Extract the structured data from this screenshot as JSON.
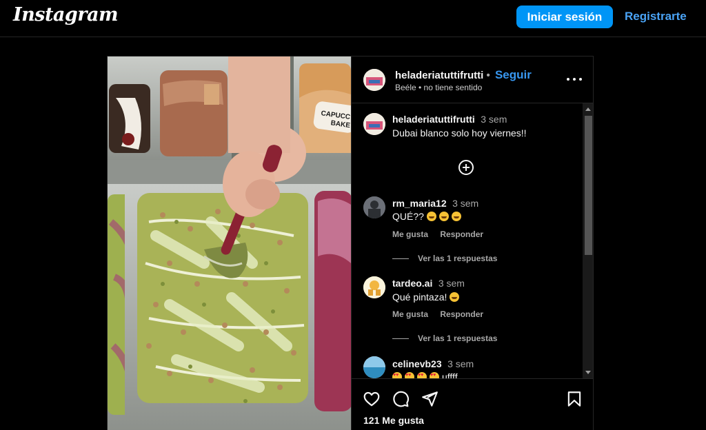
{
  "app": {
    "logo": "Instagram",
    "login_label": "Iniciar sesión",
    "register_label": "Registrarte"
  },
  "post": {
    "username": "heladeriatuttifrutti",
    "follow_label": "Seguir",
    "audio": "Beéle • no tiene sentido",
    "likes": "121 Me gusta"
  },
  "caption": {
    "username": "heladeriatuttifrutti",
    "time": "3 sem",
    "text": "Dubai blanco solo hoy viernes!!"
  },
  "comments": [
    {
      "username": "rm_maria12",
      "time": "3 sem",
      "text": "QUÉ?? ",
      "emojis": [
        "grin",
        "grin",
        "grin"
      ],
      "like_label": "Me gusta",
      "reply_label": "Responder",
      "replies_label": "Ver las 1 respuestas"
    },
    {
      "username": "tardeo.ai",
      "time": "3 sem",
      "text": "Qué pintaza! ",
      "emojis": [
        "grin"
      ],
      "like_label": "Me gusta",
      "reply_label": "Responder",
      "replies_label": "Ver las 1 respuestas"
    },
    {
      "username": "celinevb23",
      "time": "3 sem",
      "text": "uffff",
      "emojis": [
        "heart-eyes",
        "heart-eyes",
        "heart-eyes",
        "heart-eyes"
      ]
    }
  ],
  "icons": {
    "more": "more-options-icon",
    "add": "add-circle-icon",
    "like": "heart-icon",
    "comment": "comment-icon",
    "share": "share-icon",
    "save": "bookmark-icon"
  },
  "colors": {
    "accent": "#0095f6",
    "link": "#4aa3f5",
    "background": "#000000",
    "muted": "#a8a8a8"
  }
}
